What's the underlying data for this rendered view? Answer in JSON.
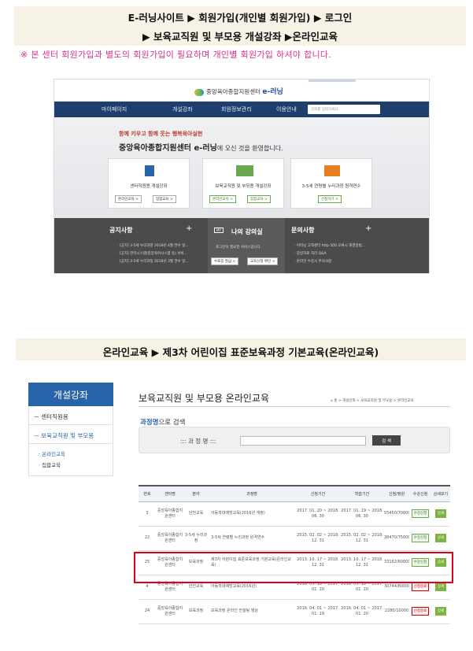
{
  "header1": {
    "line1": "E-러닝사이트 ▶ 회원가입(개인별 회원가입) ▶ 로그인",
    "line2": "▶ 보육교직원 및 부모용 개설강좌 ▶온라인교육"
  },
  "notice": "※ 본 센터 회원가입과 별도의 회원가입이 필요하며 개인별 회원가입 하셔야 합니다.",
  "shot1": {
    "logo_small": "중앙육아종합지원센터",
    "logo_brand": "e-러닝",
    "nav": [
      "마이페이지",
      "개설강좌",
      "회원정보관리",
      "이용안내"
    ],
    "search_placeholder": "강좌를 입력하세요.",
    "hero_sub": "함께 키우고 함께 웃는 행복육아실현",
    "hero_title": "중앙육아종합지원센터 e-러닝",
    "hero_title_tail": "에 오신 것을 환영합니다.",
    "cards": [
      {
        "label": "센터직원용 개설강좌",
        "btn1": "온라인교육 >",
        "btn2": "집합교육 >"
      },
      {
        "label": "보육교직원 및 부모용 개설강좌",
        "btn1": "온라인교육 >",
        "btn2": "집합교육 >"
      },
      {
        "label": "3-5세 연령별 누리과정 원격연수",
        "btn1": "신청하기 >"
      }
    ],
    "notice_title": "공지사항",
    "notice_lines": [
      "· [공지] 3-5세 누리과정 2018년 4월 연수 일...",
      "· [공지] 관리시스템(중앙육아시스템 등) 서비...",
      "· [공지] 3-5세 누리과정 2018년 3월 연수 일..."
    ],
    "my_room_badge": "MY",
    "my_room_title": "나의 강의실",
    "my_room_text": "로그인이 필요한 서비스입니다.",
    "my_room_btn1": "수료증 발급 >",
    "my_room_btn2": "교육신청 확인 >",
    "faq_title": "문의사항",
    "faq_lines": [
      "· 이러닝 고객센터 http 500 오류시 해결방법...",
      "· 증빙자료 처리 Q&A",
      "· 온라인 수강시 주의사항"
    ],
    "plus": "+"
  },
  "header2": "온라인교육 ▶ 제3차 어린이집 표준보육과정 기본교육(온라인교육)",
  "sidebar": {
    "heading": "개설강좌",
    "items": [
      "ㅡ 센터직원용",
      "ㅡ 보육교직원 및 부모용"
    ],
    "subs": [
      "· 온라인교육",
      "· 집합교육"
    ]
  },
  "page_title": "보육교직원 및 부모용 온라인교육",
  "breadcrumb": "⌂ 홈 > 개설강좌 > 보육교직원 및 부모용 > 온라인교육",
  "search": {
    "label_a": "과정명",
    "label_b": "으로 검색",
    "field_label": "::: 과 정 명 :::",
    "button": "검 색"
  },
  "table": {
    "headers": [
      "번호",
      "센터명",
      "분야",
      "과정명",
      "신청기간",
      "학습기간",
      "신청/정원",
      "수강신청",
      "상세보기"
    ],
    "rows": [
      {
        "no": "3",
        "center": "중앙육아종합지원센터",
        "field": "안전교육",
        "course": "아동학대예방교육(2016년 개정)",
        "apply": "2017. 01. 20 ~ 2018. 06. 30",
        "study": "2017. 01. 19 ~ 2018. 06. 30",
        "count": "55450/70000",
        "status": "수강신청",
        "detail": "상세"
      },
      {
        "no": "22",
        "center": "중앙육아종합지원센터",
        "field": "3-5세 누리과정",
        "course": "3-5세 연령별 누리과정 원격연수",
        "apply": "2015. 02. 02 ~ 2018. 12. 31",
        "study": "2015. 02. 02 ~ 2018. 12. 31",
        "count": "38470/75000",
        "status": "수강신청",
        "detail": "상세"
      },
      {
        "no": "25",
        "center": "중앙육아종합지원센터",
        "field": "보육과정",
        "course": "제3차 어린이집 표준보육과정 기본교육(온라인교육)",
        "apply": "2013. 10. 17 ~ 2018. 12. 31",
        "study": "2013. 10. 17 ~ 2018. 12. 31",
        "count": "33162/60000",
        "status": "수강신청",
        "detail": "상세"
      },
      {
        "no": "4",
        "center": "중앙육아종합지원센터",
        "field": "안전교육",
        "course": "아동학대예방교육(2016년)",
        "apply": "2016. 05. 18 ~ 2017. 01. 20",
        "study": "2016. 05. 18 ~ 2017. 01. 20",
        "count": "30744/80000",
        "status": "신청종료",
        "detail": "상세"
      },
      {
        "no": "24",
        "center": "중앙육아종합지원센터",
        "field": "보육과정",
        "course": "보육과정 온라인 컨설팅 영상",
        "apply": "2016. 04. 01 ~ 2017. 01. 19",
        "study": "2016. 04. 01 ~ 2017. 01. 20",
        "count": "2280/10000",
        "status": "신청종료",
        "detail": "상세"
      }
    ]
  }
}
